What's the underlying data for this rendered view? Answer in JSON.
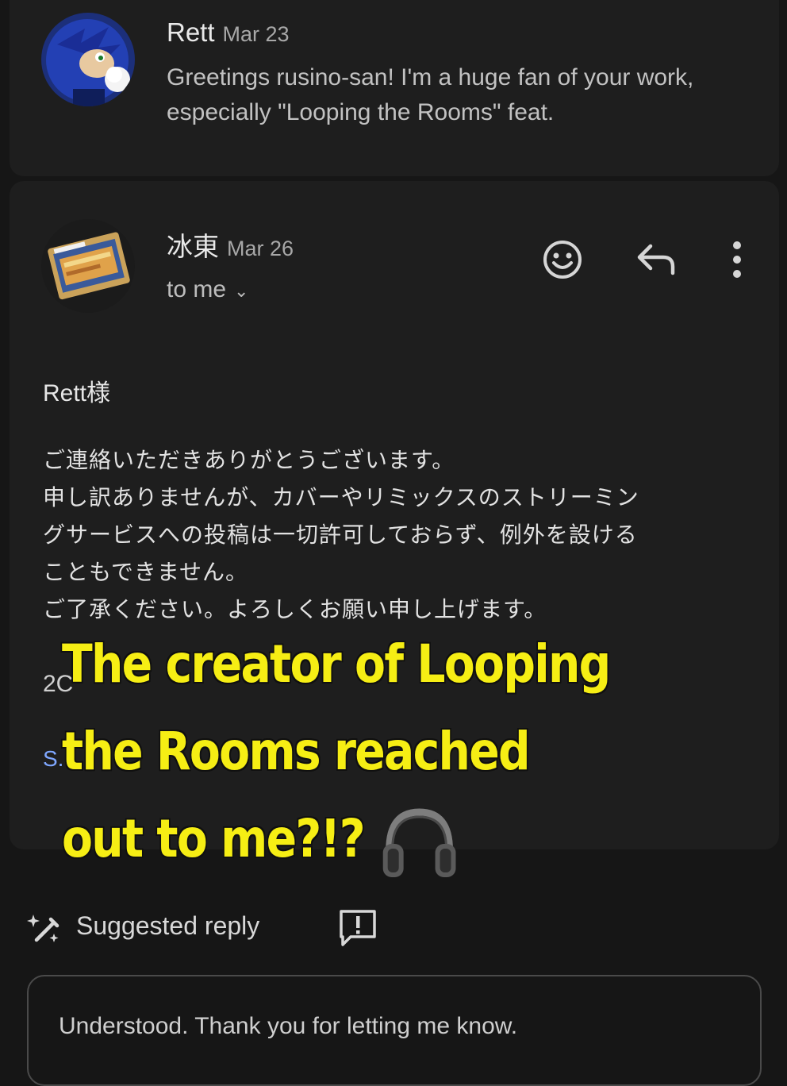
{
  "thread": [
    {
      "sender": "Rett",
      "date": "Mar 23",
      "snippet": "Greetings rusino-san! I'm a huge fan of your work, especially \"Looping the Rooms\" feat."
    },
    {
      "sender": "冰東",
      "date": "Mar 26",
      "recipient": "to me",
      "salutation": "Rett様",
      "body_lines": [
        "ご連絡いただきありがとうございます。",
        "申し訳ありませんが、カバーやリミックスのストリーミン",
        "グサービスへの投稿は一切許可しておらず、例外を設ける",
        "こともできません。",
        "ご了承ください。よろしくお願い申し上げます。"
      ],
      "signature_partial": "2C",
      "link_partial": "S."
    }
  ],
  "actions": {
    "emoji_icon": "smiley-face-icon",
    "reply_icon": "reply-arrow-icon",
    "more_icon": "more-vertical-icon"
  },
  "suggested": {
    "label": "Suggested reply",
    "sparkle_icon": "pen-sparkle-icon",
    "feedback_icon": "feedback-exclamation-icon",
    "reply_text": "Understood. Thank you for letting me know."
  },
  "overlay": {
    "caption_lines": [
      "The creator of Looping",
      "the Rooms reached",
      "out to me?!?"
    ],
    "emoji": "headphones-icon",
    "color": "#f6ee14"
  }
}
